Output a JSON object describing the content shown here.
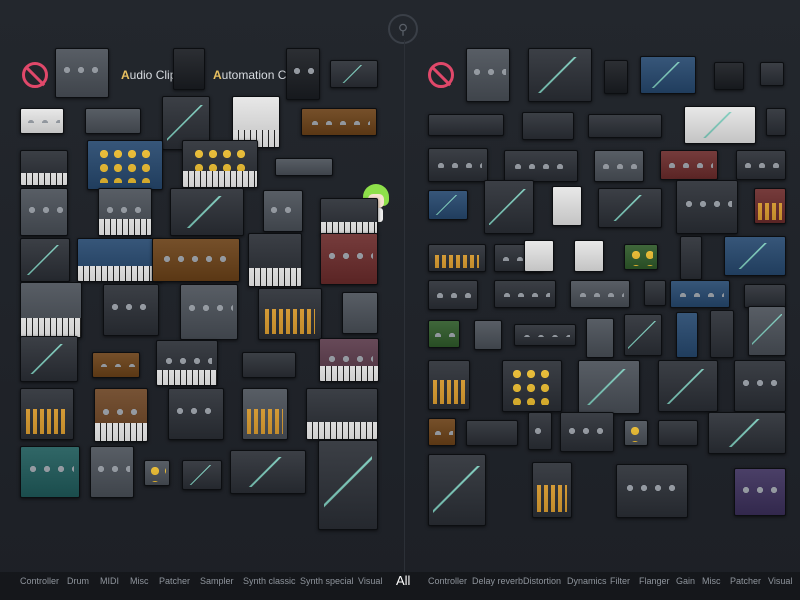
{
  "left_panel": {
    "clip_labels": [
      {
        "initial": "A",
        "rest": "udio Clip"
      },
      {
        "initial": "A",
        "rest": "utomation Clip"
      }
    ]
  },
  "tabs": {
    "left": [
      "Controller",
      "Drum",
      "MIDI",
      "Misc",
      "Patcher",
      "Sampler",
      "Synth classic",
      "Synth special",
      "Visual"
    ],
    "active": "All",
    "right": [
      "Controller",
      "Delay reverb",
      "Distortion",
      "Dynamics",
      "Filter",
      "Flanger",
      "Gain",
      "Misc",
      "Patcher",
      "Visual"
    ]
  },
  "icons": {
    "top": "search-icon",
    "empty_slot": "no-symbol-icon",
    "mascot": "mascot-icon"
  },
  "colors": {
    "background": "#1c1f24",
    "no_symbol": "#e0486a",
    "clip_initial": "#e8c060",
    "active_tab": "#ffffff",
    "inactive_tab": "#8e949c"
  }
}
